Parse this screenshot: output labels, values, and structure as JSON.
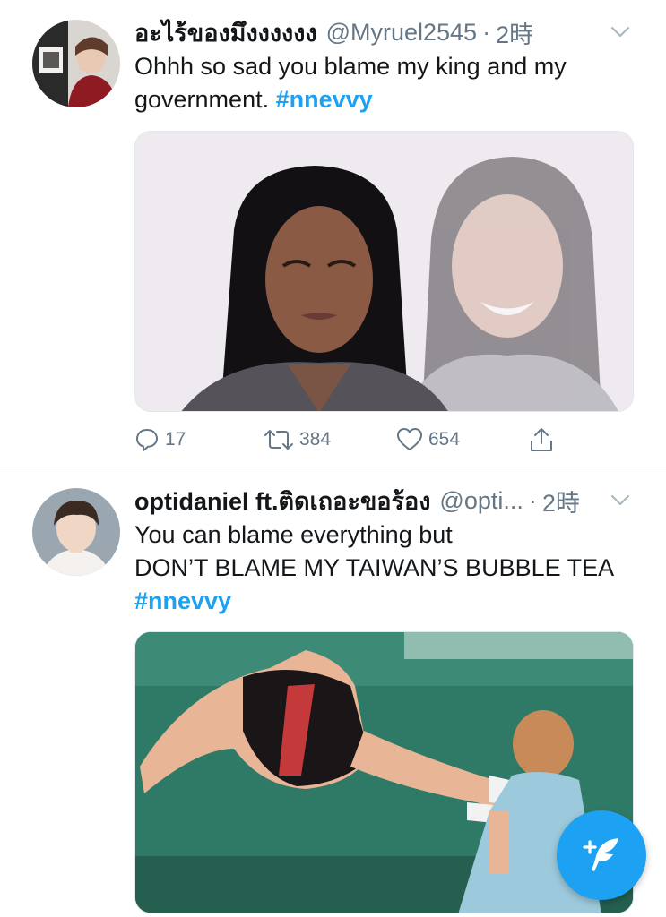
{
  "tweets": [
    {
      "display_name": "อะไร้ของมึงงงงงง",
      "handle": "@Myruel2545",
      "separator": "·",
      "time": "2時",
      "text_line1": "Ohhh so sad you blame my king and my",
      "text_line2": "government.",
      "hashtag": "#nnevvy",
      "actions": {
        "replies": "17",
        "retweets": "384",
        "likes": "654"
      }
    },
    {
      "display_name": "optidaniel ft.ติดเถอะขอร้อง",
      "handle": "@opti...",
      "separator": "·",
      "time": "2時",
      "text_line1": "You can blame everything but",
      "text_line2": "DON’T BLAME MY TAIWAN’S BUBBLE TEA",
      "hashtag": "#nnevvy"
    }
  ],
  "icons": {
    "reply": "reply-icon",
    "retweet": "retweet-icon",
    "like": "like-icon",
    "share": "share-icon",
    "caret": "chevron-down-icon",
    "compose": "compose-tweet-icon"
  },
  "colors": {
    "accent": "#1da1f2",
    "secondary_text": "#657786",
    "primary_text": "#14171a",
    "divider": "#e6ecf0"
  }
}
